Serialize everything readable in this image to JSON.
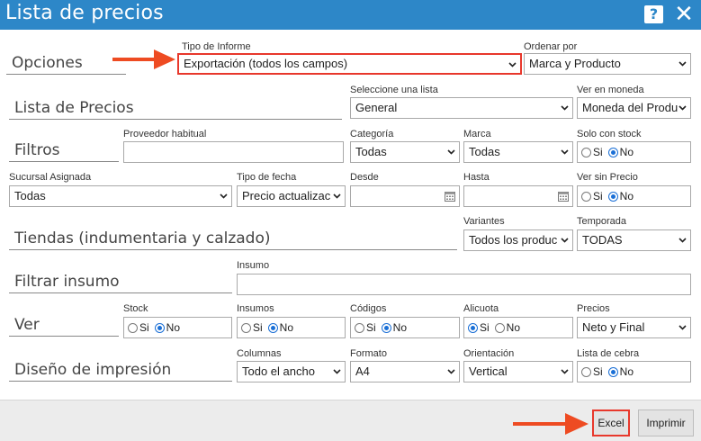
{
  "window": {
    "title": "Lista de precios",
    "help_label": "?",
    "close_label": "✕"
  },
  "sections": {
    "opciones": "Opciones",
    "lista_precios": "Lista de Precios",
    "filtros": "Filtros",
    "tiendas": "Tiendas (indumentaria y calzado)",
    "filtrar_insumo": "Filtrar insumo",
    "ver": "Ver",
    "diseno": "Diseño de impresión"
  },
  "opciones": {
    "tipo_informe": {
      "label": "Tipo de Informe",
      "value": "Exportación (todos los campos)"
    },
    "ordenar_por": {
      "label": "Ordenar por",
      "value": "Marca y Producto"
    }
  },
  "lista": {
    "seleccione": {
      "label": "Seleccione una lista",
      "value": "General"
    },
    "moneda": {
      "label": "Ver en moneda",
      "value": "Moneda del Produ"
    }
  },
  "filtros": {
    "proveedor": {
      "label": "Proveedor habitual",
      "value": ""
    },
    "categoria": {
      "label": "Categoría",
      "value": "Todas"
    },
    "marca": {
      "label": "Marca",
      "value": "Todas"
    },
    "stock": {
      "label": "Solo con stock",
      "si": "Si",
      "no": "No",
      "selected": "No"
    },
    "sucursal": {
      "label": "Sucursal Asignada",
      "value": "Todas"
    },
    "tipo_fecha": {
      "label": "Tipo de fecha",
      "value": "Precio actualizac"
    },
    "desde": {
      "label": "Desde",
      "value": ""
    },
    "hasta": {
      "label": "Hasta",
      "value": ""
    },
    "sin_precio": {
      "label": "Ver sin Precio",
      "si": "Si",
      "no": "No",
      "selected": "No"
    }
  },
  "tiendas": {
    "variantes": {
      "label": "Variantes",
      "value": "Todos los produc"
    },
    "temporada": {
      "label": "Temporada",
      "value": "TODAS"
    }
  },
  "insumo": {
    "label": "Insumo",
    "value": ""
  },
  "ver": {
    "stock": {
      "label": "Stock",
      "si": "Si",
      "no": "No",
      "selected": "No"
    },
    "insumos": {
      "label": "Insumos",
      "si": "Si",
      "no": "No",
      "selected": "No"
    },
    "codigos": {
      "label": "Códigos",
      "si": "Si",
      "no": "No",
      "selected": "No"
    },
    "alicuota": {
      "label": "Alicuota",
      "si": "Si",
      "no": "No",
      "selected": "Si"
    },
    "precios": {
      "label": "Precios",
      "value": "Neto y Final"
    }
  },
  "diseno": {
    "columnas": {
      "label": "Columnas",
      "value": "Todo el ancho"
    },
    "formato": {
      "label": "Formato",
      "value": "A4"
    },
    "orientacion": {
      "label": "Orientación",
      "value": "Vertical"
    },
    "cebra": {
      "label": "Lista de cebra",
      "si": "Si",
      "no": "No",
      "selected": "No"
    }
  },
  "footer": {
    "excel_label": "Excel",
    "print_label": "Imprimir"
  },
  "colors": {
    "titlebar": "#2d87c8",
    "highlight": "#e8382c",
    "radio": "#1a6fd6",
    "arrow": "#ee4b22"
  }
}
